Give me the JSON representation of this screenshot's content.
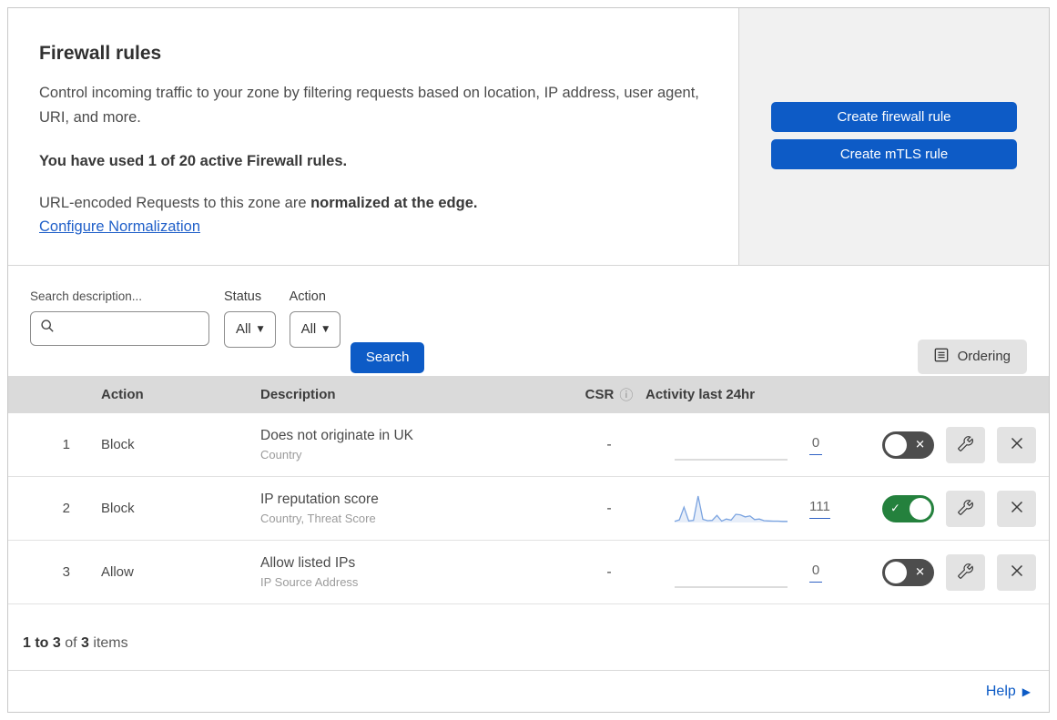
{
  "header": {
    "title": "Firewall rules",
    "description": "Control incoming traffic to your zone by filtering requests based on location, IP address, user agent, URI, and more.",
    "usage_text": "You have used 1 of 20 active Firewall rules.",
    "normalization_prefix": "URL-encoded Requests to this zone are ",
    "normalization_bold": "normalized at the edge.",
    "normalization_link": "Configure Normalization",
    "buttons": [
      {
        "label": "Create firewall rule"
      },
      {
        "label": "Create mTLS rule"
      }
    ]
  },
  "filters": {
    "search_label": "Search description...",
    "search_value": "",
    "status_label": "Status",
    "status_value": "All",
    "action_label": "Action",
    "action_value": "All",
    "search_button_label": "Search",
    "ordering_button_label": "Ordering"
  },
  "table": {
    "columns": {
      "action": "Action",
      "description": "Description",
      "csr": "CSR",
      "activity": "Activity last 24hr"
    },
    "rows": [
      {
        "index": "1",
        "action": "Block",
        "description": "Does not originate in UK",
        "criteria": "Country",
        "csr": "-",
        "activity_count": "0",
        "enabled": false,
        "activity_series": null
      },
      {
        "index": "2",
        "action": "Block",
        "description": "IP reputation score",
        "criteria": "Country, Threat Score",
        "csr": "-",
        "activity_count": "111",
        "enabled": true,
        "activity_series": [
          4,
          10,
          58,
          6,
          8,
          100,
          12,
          7,
          8,
          27,
          5,
          13,
          9,
          31,
          29,
          21,
          25,
          11,
          13,
          7,
          6,
          5,
          5,
          4,
          4
        ]
      },
      {
        "index": "3",
        "action": "Allow",
        "description": "Allow listed IPs",
        "criteria": "IP Source Address",
        "csr": "-",
        "activity_count": "0",
        "enabled": false,
        "activity_series": null
      }
    ]
  },
  "footer": {
    "range": "1 to 3",
    "of_text": " of ",
    "total": "3",
    "items_text": " items",
    "help_label": "Help"
  },
  "icons": {
    "info": "ⓘ",
    "caret_down": "▼",
    "toggle_check": "✓",
    "toggle_cross": "✕",
    "help_arrow": "▶"
  },
  "colors": {
    "accent_blue": "#0d5bc6",
    "link_blue": "#2160c9",
    "toggle_on_green": "#24813d",
    "toggle_off_gray": "#4d4d4d",
    "sparkline_blue": "#7aa3e0",
    "table_header_gray": "#dadada",
    "panel_gray": "#f1f1f1"
  }
}
